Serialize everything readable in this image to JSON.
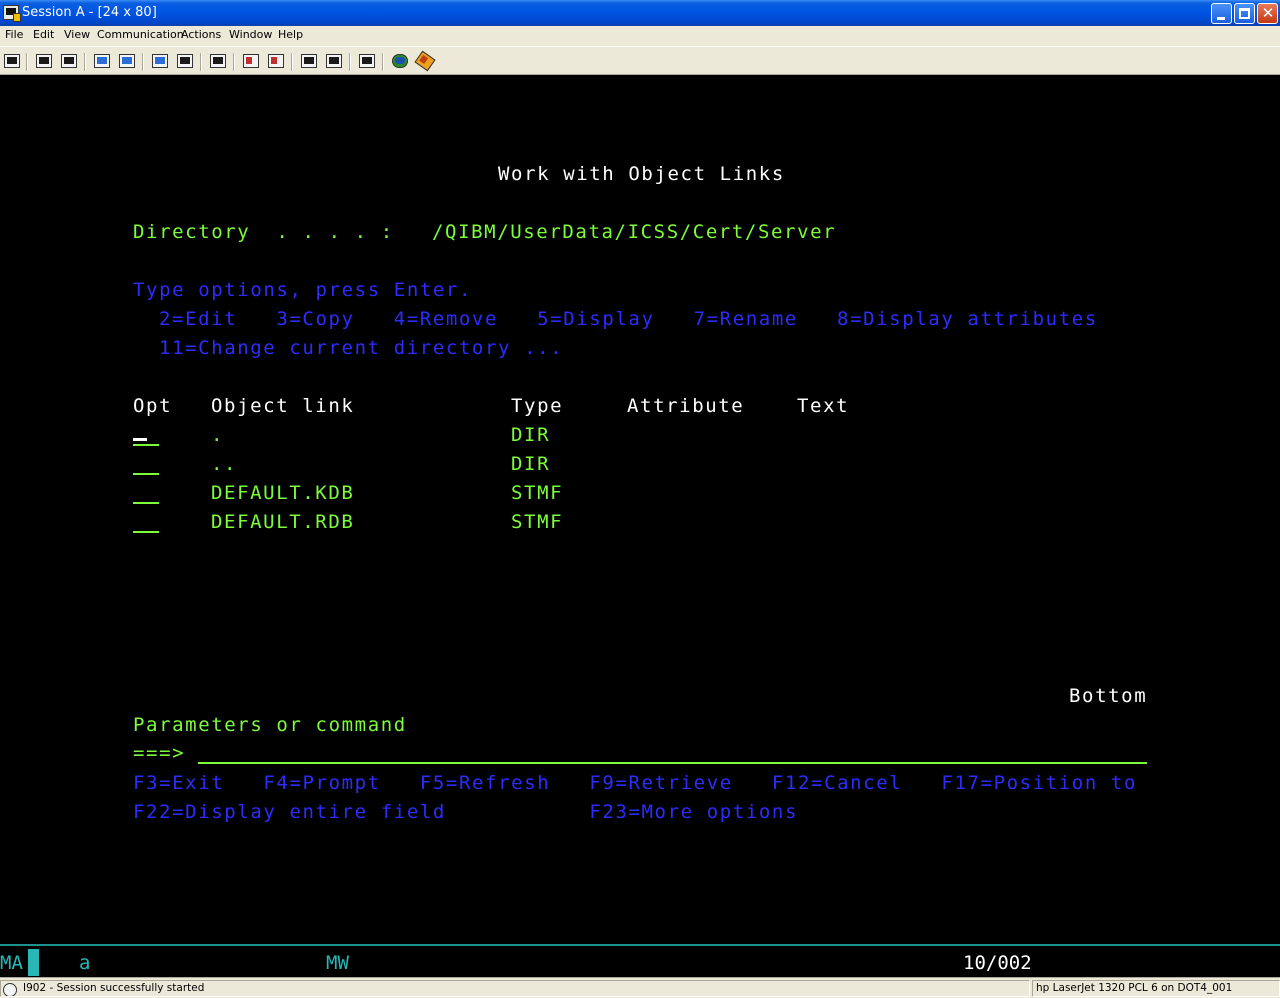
{
  "window": {
    "title": "Session A - [24 x 80]"
  },
  "menu": [
    "File",
    "Edit",
    "View",
    "Communication",
    "Actions",
    "Window",
    "Help"
  ],
  "toolbar_icons": [
    "print-screen-icon",
    "copy-icon",
    "paste-icon",
    "send-file-icon",
    "receive-file-icon",
    "display-keypad-icon",
    "macro-icon",
    "record-macro-icon",
    "play-macro-icon",
    "stop-macro-icon",
    "start-macro-icon",
    "run-macro-icon",
    "clipboard-icon",
    "connect-icon",
    "disconnect-icon"
  ],
  "screen": {
    "title": "Work with Object Links",
    "directory_label": "Directory  . . . . :",
    "directory_value": "/QIBM/UserData/ICSS/Cert/Server",
    "instructions": "Type options, press Enter.",
    "options_line1": "2=Edit   3=Copy   4=Remove   5=Display   7=Rename   8=Display attributes",
    "options_line2": "11=Change current directory ...",
    "columns": {
      "opt": "Opt",
      "object_link": "Object link",
      "type": "Type",
      "attribute": "Attribute",
      "text": "Text"
    },
    "rows": [
      {
        "object_link": ".",
        "type": "DIR"
      },
      {
        "object_link": "..",
        "type": "DIR"
      },
      {
        "object_link": "DEFAULT.KDB",
        "type": "STMF"
      },
      {
        "object_link": "DEFAULT.RDB",
        "type": "STMF"
      }
    ],
    "bottom_indicator": "Bottom",
    "command_label": "Parameters or command",
    "command_prompt": "===>",
    "command_value": "",
    "function_keys_line1": "F3=Exit   F4=Prompt   F5=Refresh   F9=Retrieve   F12=Cancel   F17=Position to",
    "function_keys_line2": "F22=Display entire field           F23=More options"
  },
  "oia": {
    "left": "MA",
    "mode": "a",
    "mw": "MW",
    "cursor_position": "10/002"
  },
  "statusbar": {
    "message": "I902 - Session successfully started",
    "printer": "hp LaserJet 1320 PCL 6 on DOT4_001"
  },
  "colors": {
    "terminal_bg": "#000000",
    "green": "#7cfc3a",
    "blue": "#2c2cff",
    "white": "#ffffff",
    "oia_cyan": "#29b6b6"
  }
}
